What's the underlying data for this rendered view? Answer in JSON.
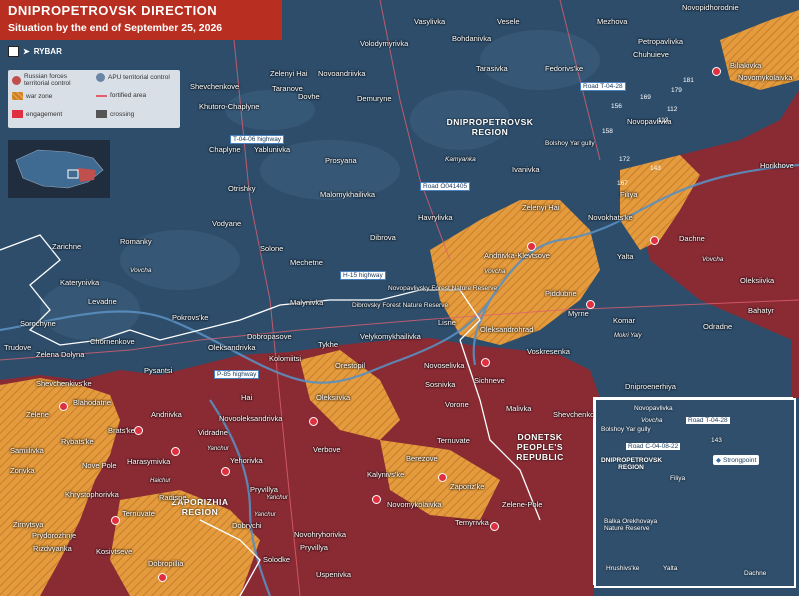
{
  "header": {
    "title": "DNIPROPETROVSK DIRECTION",
    "subtitle": "Situation by the end of September 25, 2026",
    "brand": "RYBAR"
  },
  "legend": {
    "items": [
      {
        "label": "Russian forces territorial control",
        "color": "#c0504d"
      },
      {
        "label": "APU territorial control",
        "color": "#6a86a6"
      },
      {
        "label": "war zone",
        "color": "#f0a040"
      },
      {
        "label": "fortified area",
        "color": "#e06070"
      },
      {
        "label": "engagement",
        "color": "#e03040"
      },
      {
        "label": "crossing",
        "color": "#555555"
      }
    ]
  },
  "colors": {
    "ukraine_control": "#2d4d6b",
    "russia_control": "#8a2b34",
    "war_zone": "#e39b3d",
    "header_red": "#b82e20"
  },
  "regions": {
    "dnipropetrovsk": "DNIPROPETROVSK REGION",
    "donetsk": "DONETSK PEOPLE'S REPUBLIC",
    "zaporizhia": "ZAPORIZHIA REGION"
  },
  "roads": {
    "t0428": "Road T-04-28",
    "t0406": "T-04-06 highway",
    "o041405": "Road O041405",
    "h15": "H-15 highway",
    "p85": "P-85 highway"
  },
  "natural_areas": {
    "bolshoy_yar": "Bolshoy Yar gully",
    "dibrovsky": "Dibrovsky Forest Nature Reserve",
    "novopavlivsky": "Novopavlivsky Forest Nature Reserve"
  },
  "settlements": {
    "vasylivka": "Vasylivka",
    "vesele": "Vesele",
    "mezhova": "Mezhova",
    "novopidhorodnie": "Novopidhorodnie",
    "bohdanivka": "Bohdanivka",
    "volodymyrivka": "Volodymyrivka",
    "petropavlivka": "Petropavlivka",
    "shevchenkove_n": "Shevchenkove",
    "zelenyi_hai_n": "Zelenyi Hai",
    "novoandriivka": "Novoandriivka",
    "tarasivka": "Tarasivka",
    "fedorivske": "Fedorivs'ke",
    "chuhuieve": "Chuhuieve",
    "biliakivka": "Biliakivka",
    "novomykolaivka": "Novomykolaivka",
    "khutoro_chaplyne": "Khutoro-Chaplyne",
    "taranove": "Taranove",
    "dovhe": "Dovhe",
    "demurynе": "Demuryne",
    "chaplyne": "Chaplyne",
    "yablunivka": "Yablunivka",
    "prosyana": "Prosyana",
    "kamyanka": "Kamyanka",
    "ivanivka": "Ivanivka",
    "novopavlivka_n": "Novopavlivka",
    "horikhove": "Horikhove",
    "otrishky": "Otrishky",
    "malomykhailivka": "Malomykhailivka",
    "filiya": "Filiya",
    "vodyane": "Vodyane",
    "havrylivka": "Havrylivka",
    "zelenyi_hai_c": "Zelenyi Hai",
    "novokhatske": "Novokhats'ke",
    "dachne": "Dachne",
    "zarichne": "Zarichne",
    "romanky": "Romanky",
    "solone": "Solone",
    "dibrova": "Dibrova",
    "mechetne": "Mechetne",
    "andriivka_klevtsove": "Andriivka-Klevtsove",
    "yalta": "Yalta",
    "oleksiivka_e": "Oleksiivka",
    "katerynivka": "Katerynivka",
    "voscha_w": "Vovcha",
    "voscha_c": "Vovcha",
    "voscha_e": "Vovcha",
    "levadne": "Levadne",
    "malynivka": "Malynivka",
    "piddubne": "Piddubne",
    "bahatyr": "Bahatyr",
    "sorochyne": "Sorochyne",
    "pokrovske": "Pokrovs'ke",
    "lisne": "Lisne",
    "myrne": "Myrne",
    "komar": "Komar",
    "odradne": "Odradne",
    "trudove": "Trudove",
    "chornenkove": "Chornenkove",
    "dobropasove": "Dobropasove",
    "oleksandrohrad": "Oleksandrohrad",
    "mokri_yaly": "Mokri Yaly",
    "zelena_dolyna": "Zelena Dolyna",
    "oleksandrivka": "Oleksandrivka",
    "kolomiitsi": "Kolomiitsi",
    "tykhe": "Tykhe",
    "velykomykhailivka": "Velykomykhailivka",
    "voskresenka": "Voskresenka",
    "pysantsi": "Pysantsi",
    "orestopil": "Orestopil",
    "novoselivka": "Novoselivka",
    "sichneve": "Sichneve",
    "dniproenerhiya": "Dniproenerhiya",
    "shevchenkivske": "Shevchenkivs'ke",
    "sosnivka": "Sosnivka",
    "blahodatne": "Blahodatne",
    "hai": "Hai",
    "oleksiivka_c": "Oleksiivka",
    "vorone": "Vorone",
    "malivka": "Malivka",
    "shevchenko_e": "Shevchenko",
    "zelene": "Zelene",
    "andriivka_w": "Andriivka",
    "novooleksandrivka": "Novooleksandrivka",
    "vidradne": "Vidradne",
    "brats_ke": "Brats'ke",
    "rybats_ke": "Rybats'ke",
    "verbove": "Verbove",
    "ternuvate_c": "Ternuvate",
    "samiilivka": "Samiilivka",
    "harasymivka": "Harasymivka",
    "yehorivka": "Yehorivka",
    "berezove": "Berezove",
    "kalynivske": "Kalynivs'ke",
    "zorivka": "Zorivka",
    "nove_pole": "Nove Pole",
    "pryvillya_w": "Pryvillya",
    "zaporizke": "Zaporiz'ke",
    "khrystoforivka": "Khrystophorivka",
    "radisne": "Radisne",
    "novomykolaivka_s": "Novomykolaivka",
    "zelene_pole": "Zelene-Pole",
    "zirnytsya": "Zirnytsya",
    "prydorozhnje": "Prydorozhnje",
    "ternuvate_s": "Ternuvate",
    "temyrivka": "Temyrivka",
    "dobrychi": "Dobrychi",
    "novohryhorivka": "Novohryhorivka",
    "rizdvyanka": "Rizdvyanka",
    "kosivtseve": "Kosivtseve",
    "dobropillia": "Dobropillia",
    "solodke": "Solodke",
    "pryvillya_s": "Pryvillya",
    "uspenivka": "Uspenivka",
    "yanchur_n": "Yanchur",
    "yanchur_c": "Yanchur",
    "haichur": "Haichur",
    "yanchur_s": "Yanchur"
  },
  "heights": [
    "181",
    "179",
    "169",
    "156",
    "112",
    "158",
    "113",
    "172",
    "167",
    "143"
  ],
  "inset": {
    "novopavlivka": "Novopavlivka",
    "road_t0428": "Road T-04-28",
    "vovcha": "Vovcha",
    "bolshoy_yar": "Bolshoy Yar gully",
    "road_c0408": "Road C-04-08-22",
    "region": "DNIPROPETROVSK REGION",
    "filiya": "Filiya",
    "strongpoint": "Strongpoint",
    "balka": "Balka Orekhovaya Nature Reserve",
    "hrushivske": "Hrushivs'ke",
    "yalta": "Yalta",
    "dachne": "Dachne",
    "h143": "143"
  }
}
